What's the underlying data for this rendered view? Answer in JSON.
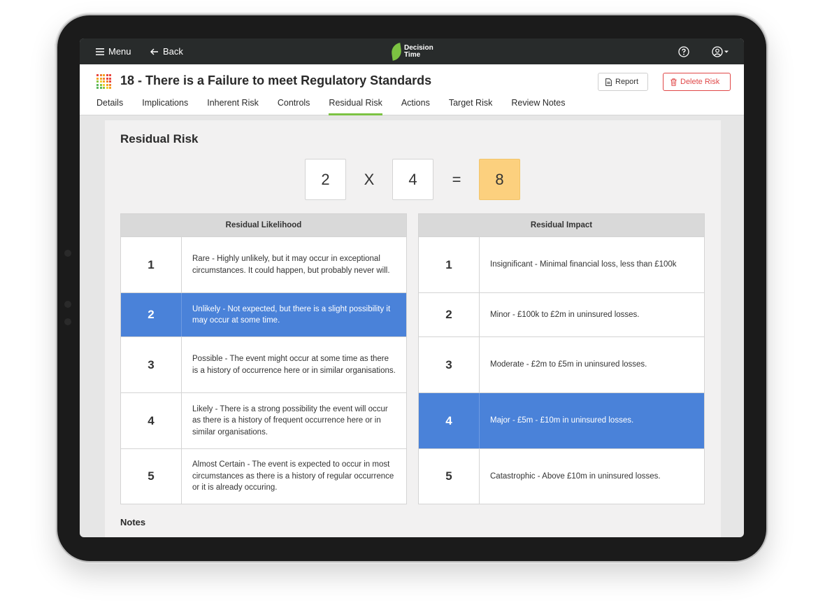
{
  "topbar": {
    "menu_label": "Menu",
    "back_label": "Back",
    "logo_text": "Decision Time"
  },
  "risk": {
    "title": "18 - There is a Failure to meet Regulatory Standards"
  },
  "actions": {
    "report_label": "Report",
    "delete_label": "Delete Risk"
  },
  "tabs": [
    {
      "label": "Details"
    },
    {
      "label": "Implications"
    },
    {
      "label": "Inherent Risk"
    },
    {
      "label": "Controls"
    },
    {
      "label": "Residual Risk",
      "active": true
    },
    {
      "label": "Actions"
    },
    {
      "label": "Target Risk"
    },
    {
      "label": "Review Notes"
    }
  ],
  "residual": {
    "title": "Residual Risk",
    "likelihood_value": "2",
    "operator": "X",
    "impact_value": "4",
    "equals": "=",
    "score": "8",
    "score_color": "#fcd07e"
  },
  "likelihood_table": {
    "header": "Residual Likelihood",
    "rows": [
      {
        "num": "1",
        "text": "Rare - Highly unlikely, but it may occur in exceptional circumstances. It could happen, but probably never will."
      },
      {
        "num": "2",
        "text": "Unlikely - Not expected, but there is a slight possibility it may occur at some time."
      },
      {
        "num": "3",
        "text": "Possible - The event might occur at some time as there is a history of occurrence here or in similar organisations."
      },
      {
        "num": "4",
        "text": "Likely - There is a strong possibility the event will occur as there is a history of frequent occurrence here or in similar organisations."
      },
      {
        "num": "5",
        "text": "Almost Certain - The event is expected to occur in most circumstances as there is a history of regular occurrence or it is already occuring."
      }
    ]
  },
  "impact_table": {
    "header": "Residual Impact",
    "rows": [
      {
        "num": "1",
        "text": "Insignificant - Minimal financial loss, less than £100k"
      },
      {
        "num": "2",
        "text": "Minor - £100k to £2m in uninsured losses."
      },
      {
        "num": "3",
        "text": "Moderate - £2m to £5m in uninsured losses."
      },
      {
        "num": "4",
        "text": "Major - £5m - £10m in uninsured losses."
      },
      {
        "num": "5",
        "text": "Catastrophic - Above £10m in uninsured losses."
      }
    ]
  },
  "notes": {
    "title": "Notes"
  },
  "colors": {
    "accent_green": "#7cc242",
    "selected_blue": "#4a82d9",
    "delete_red": "#e04848"
  },
  "icons": [
    "menu-icon",
    "back-arrow-icon",
    "help-icon",
    "user-account-icon",
    "report-document-icon",
    "trash-icon",
    "risk-heatmap-icon"
  ]
}
